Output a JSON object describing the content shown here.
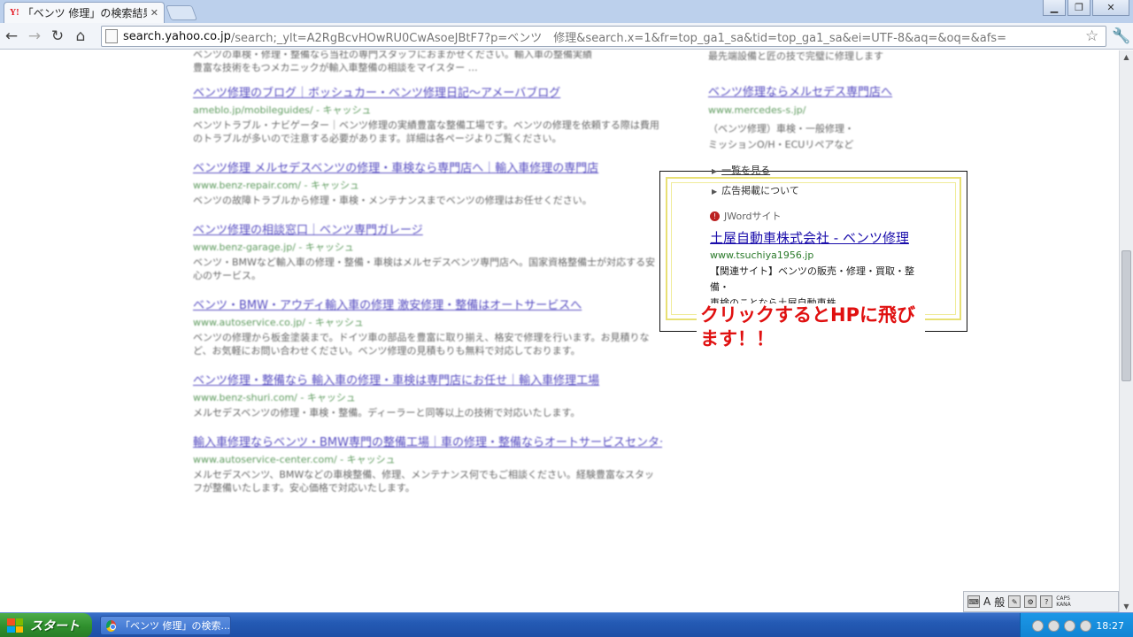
{
  "browser": {
    "tab_title": "「ベンツ 修理」の検索結果",
    "tab_icon": "Y!",
    "address_host": "search.yahoo.co.jp",
    "address_rest": "/search;_ylt=A2RgBcvHOwRU0CwAsoeJBtF7?p=ベンツ　修理&search.x=1&fr=top_ga1_sa&tid=top_ga1_sa&ei=UTF-8&aq=&oq=&afs="
  },
  "top_snippet": {
    "line1": "ベンツの車検・修理・整備なら当社の専門スタッフにおまかせください。輸入車の整備実績",
    "line2": "豊富な技術をもつメカニックが輸入車整備の相談をマイスター …"
  },
  "results": [
    {
      "title": "ベンツ修理のブログ｜ボッシュカー・ベンツ修理日記～アメーバブログ",
      "url": "ameblo.jp/mobileguides/ - キャッシュ",
      "desc": "ベンツトラブル・ナビゲーター｜ベンツ修理の実績豊富な整備工場です。ベンツの修理を依頼する際は費用のトラブルが多いので注意する必要があります。詳細は各ページよりご覧ください。"
    },
    {
      "title": "ベンツ修理 メルセデスベンツの修理・車検なら専門店へ｜輸入車修理の専門店",
      "url": "www.benz-repair.com/ - キャッシュ",
      "desc": "ベンツの故障トラブルから修理・車検・メンテナンスまでベンツの修理はお任せください。"
    },
    {
      "title": "ベンツ修理の相談窓口｜ベンツ専門ガレージ",
      "url": "www.benz-garage.jp/ - キャッシュ",
      "desc": "ベンツ・BMWなど輸入車の修理・整備・車検はメルセデスベンツ専門店へ。国家資格整備士が対応する安心のサービス。"
    },
    {
      "title": "ベンツ・BMW・アウディ輸入車の修理 激安修理・整備はオートサービスへ",
      "url": "www.autoservice.co.jp/ - キャッシュ",
      "desc": "ベンツの修理から板金塗装まで。ドイツ車の部品を豊富に取り揃え、格安で修理を行います。お見積りなど、お気軽にお問い合わせください。ベンツ修理の見積もりも無料で対応しております。"
    },
    {
      "title": "ベンツ修理・整備なら 輸入車の修理・車検は専門店にお任せ｜輸入車修理工場",
      "url": "www.benz-shuri.com/ - キャッシュ",
      "desc": "メルセデスベンツの修理・車検・整備。ディーラーと同等以上の技術で対応いたします。"
    },
    {
      "title": "輸入車修理ならベンツ・BMW専門の整備工場｜車の修理・整備ならオートサービスセンター",
      "url": "www.autoservice-center.com/ - キャッシュ",
      "desc": "メルセデスベンツ、BMWなどの車検整備、修理、メンテナンス何でもご相談ください。経験豊富なスタッフが整備いたします。安心価格で対応いたします。"
    }
  ],
  "sidebar": {
    "line1": "最先端設備と匠の技で完璧に修理します",
    "ad_title": "ベンツ修理ならメルセデス専門店へ",
    "ad_url": "www.mercedes-s.jp/",
    "ad_desc1": "（ベンツ修理）車検・一般修理・",
    "ad_desc2": "ミッションO/H・ECUリペアなど"
  },
  "highlight": {
    "see_all": "一覧を見る",
    "about_ads": "広告掲載について",
    "source": "JWordサイト",
    "title": "土屋自動車株式会社 - ベンツ修理",
    "url": "www.tsuchiya1956.jp",
    "desc1": "【関連サイト】ベンツの販売・修理・買取・整備・",
    "desc2": "車検のことなら土屋自動車株...",
    "callout": "クリックするとHPに飛びます！！"
  },
  "ime": {
    "mode": "A",
    "kanji": "般",
    "caps": "CAPS",
    "kana": "KANA"
  },
  "taskbar": {
    "start": "スタート",
    "task_label": "「ベンツ 修理」の検索...",
    "clock": "18:27"
  }
}
